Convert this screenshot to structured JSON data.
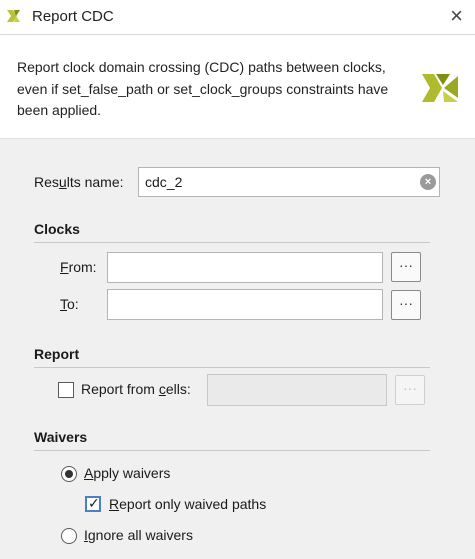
{
  "window": {
    "title": "Report CDC",
    "app_icon": "vivado-logo-icon",
    "close_icon": "close-icon"
  },
  "header": {
    "description": "Report clock domain crossing (CDC) paths between clocks, even if set_false_path or set_clock_groups constraints have been applied."
  },
  "results": {
    "label_pre": "Res",
    "label_u": "u",
    "label_post": "lts name:",
    "value": "cdc_2"
  },
  "clocks": {
    "title": "Clocks",
    "from_label_u": "F",
    "from_label_post": "rom:",
    "from_value": "",
    "to_label_u": "T",
    "to_label_post": "o:",
    "to_value": "",
    "browse_label": "···"
  },
  "report": {
    "title": "Report",
    "from_cells_pre": "Report from ",
    "from_cells_u": "c",
    "from_cells_post": "ells:",
    "from_cells_checked": false,
    "browse_label": "···"
  },
  "waivers": {
    "title": "Waivers",
    "apply_pre": "",
    "apply_u": "A",
    "apply_post": "pply waivers",
    "apply_selected": true,
    "only_waived_pre": "",
    "only_waived_u": "R",
    "only_waived_post": "eport only waived paths",
    "only_waived_checked": true,
    "ignore_pre": "",
    "ignore_u": "I",
    "ignore_post": "gnore all waivers",
    "ignore_selected": false
  },
  "colors": {
    "accent": "#4a7fc1",
    "logo_dark": "#7e8f12",
    "logo_light": "#c6cf4a"
  }
}
